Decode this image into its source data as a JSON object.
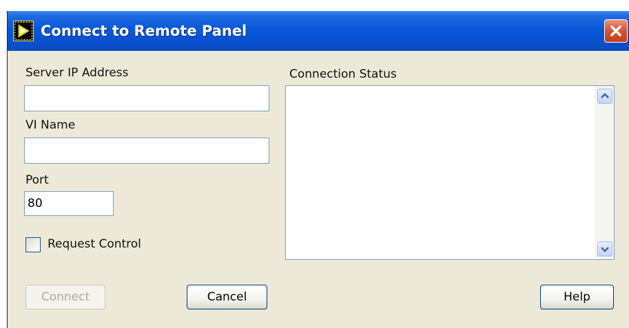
{
  "window": {
    "title": "Connect to Remote Panel",
    "icon": "labview-run-icon",
    "close_icon": "close-icon"
  },
  "form": {
    "server_ip_label": "Server IP Address",
    "server_ip_value": "",
    "vi_name_label": "VI Name",
    "vi_name_value": "",
    "port_label": "Port",
    "port_value": "80",
    "request_control_label": "Request Control",
    "request_control_checked": false
  },
  "status": {
    "label": "Connection Status",
    "text": ""
  },
  "buttons": {
    "connect": "Connect",
    "connect_enabled": false,
    "cancel": "Cancel",
    "help": "Help"
  },
  "colors": {
    "titlebar": "#0A58D8",
    "dialog_bg": "#ECE9D8",
    "close": "#D45733"
  }
}
